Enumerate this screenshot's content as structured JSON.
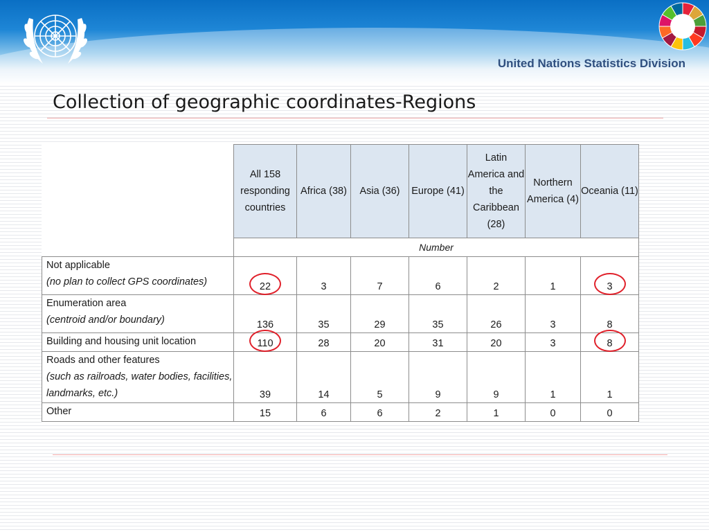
{
  "header": {
    "division_name": "United Nations Statistics Division"
  },
  "page": {
    "title": "Collection of geographic coordinates-Regions"
  },
  "table": {
    "columns": [
      "All 158 responding countries",
      "Africa (38)",
      "Asia (36)",
      "Europe (41)",
      "Latin America and the Caribbean (28)",
      "Northern America (4)",
      "Oceania (11)"
    ],
    "unit": "Number",
    "rows": [
      {
        "label": "Not applicable",
        "sublabel": "(no plan to collect GPS coordinates)",
        "values": [
          "22",
          "3",
          "7",
          "6",
          "2",
          "1",
          "3"
        ]
      },
      {
        "label": "Enumeration area",
        "sublabel": "(centroid and/or boundary)",
        "values": [
          "136",
          "35",
          "29",
          "35",
          "26",
          "3",
          "8"
        ]
      },
      {
        "label": "Building and housing unit location",
        "sublabel": "",
        "values": [
          "110",
          "28",
          "20",
          "31",
          "20",
          "3",
          "8"
        ]
      },
      {
        "label": "Roads and other features",
        "sublabel": "(such as railroads, water bodies, facilities, landmarks, etc.)",
        "values": [
          "39",
          "14",
          "5",
          "9",
          "9",
          "1",
          "1"
        ]
      },
      {
        "label": "Other",
        "sublabel": "",
        "values": [
          "15",
          "6",
          "6",
          "2",
          "1",
          "0",
          "0"
        ]
      }
    ],
    "highlight_color": "#e0202a",
    "header_fill": "#dce6f1"
  },
  "icons": {
    "left_logo": "un-emblem-icon",
    "right_logo": "sdg-wheel-icon"
  }
}
